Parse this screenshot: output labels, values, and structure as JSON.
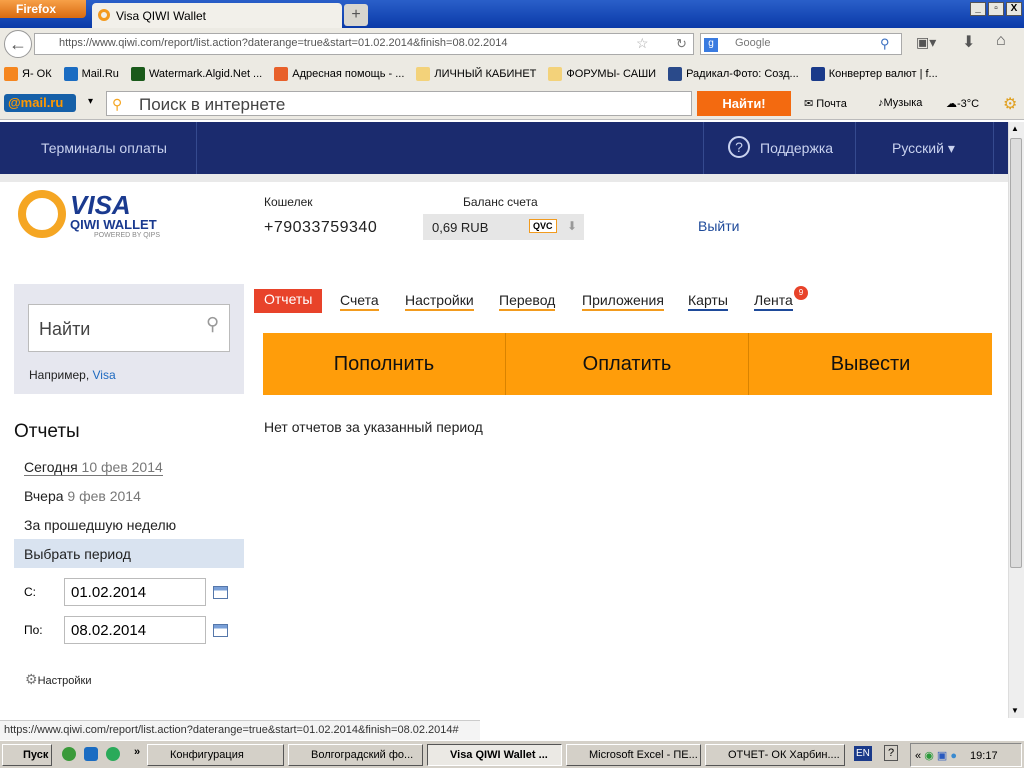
{
  "browser": {
    "menu_button": "Firefox",
    "tab_title": "Visa QIWI Wallet",
    "new_tab": "+",
    "url": "https://www.qiwi.com/report/list.action?daterange=true&start=01.02.2014&finish=08.02.2014",
    "search_placeholder": "Google",
    "bookmarks": [
      "Я- ОК",
      "Mail.Ru",
      "Watermark.Algid.Net ...",
      "Адресная помощь - ...",
      "ЛИЧНЫЙ КАБИНЕТ",
      "ФОРУМЫ- САШИ",
      "Радикал-Фото: Созд...",
      "Конвертер валют | f..."
    ],
    "mail_logo": "@mail.ru",
    "mail_search_placeholder": "Поиск в интернете",
    "find_button": "Найти!",
    "mail_link": "Почта",
    "music_link": "Музыка",
    "weather": "-3°C",
    "status_url": "https://www.qiwi.com/report/list.action?daterange=true&start=01.02.2014&finish=08.02.2014#"
  },
  "header": {
    "terminals": "Терминалы оплаты",
    "support": "Поддержка",
    "language": "Русский ▾"
  },
  "logo": {
    "visa": "VISA",
    "wallet": "QIWI WALLET",
    "powered": "POWERED BY QIPS"
  },
  "account": {
    "wallet_label": "Кошелек",
    "wallet_number": "+79033759340",
    "balance_label": "Баланс счета",
    "balance": "0,69 RUB",
    "qvc": "QVC",
    "logout": "Выйти"
  },
  "search": {
    "placeholder": "Найти",
    "example_label": "Например,",
    "example_link": "Visa"
  },
  "menu": [
    {
      "label": "Отчеты",
      "active": true
    },
    {
      "label": "Счета"
    },
    {
      "label": "Настройки"
    },
    {
      "label": "Перевод"
    },
    {
      "label": "Приложения"
    },
    {
      "label": "Карты"
    },
    {
      "label": "Лента",
      "badge": "9"
    }
  ],
  "actions": [
    "Пополнить",
    "Оплатить",
    "Вывести"
  ],
  "reports": {
    "title": "Отчеты",
    "today": "Сегодня",
    "today_date": "10 фев 2014",
    "yesterday": "Вчера",
    "yesterday_date": "9 фев 2014",
    "week": "За прошедшую неделю",
    "period": "Выбрать период",
    "from_label": "С:",
    "from": "01.02.2014",
    "to_label": "По:",
    "to": "08.02.2014",
    "settings": "Настройки"
  },
  "main": {
    "empty": "Нет отчетов за указанный период"
  },
  "taskbar": {
    "start": "Пуск",
    "items": [
      "Конфигурация",
      "Волгоградский фо...",
      "Visa QIWI Wallet ...",
      "Microsoft Excel - ПЕ...",
      "ОТЧЕТ- ОК Харбин...."
    ],
    "lang": "EN",
    "clock": "19:17"
  }
}
